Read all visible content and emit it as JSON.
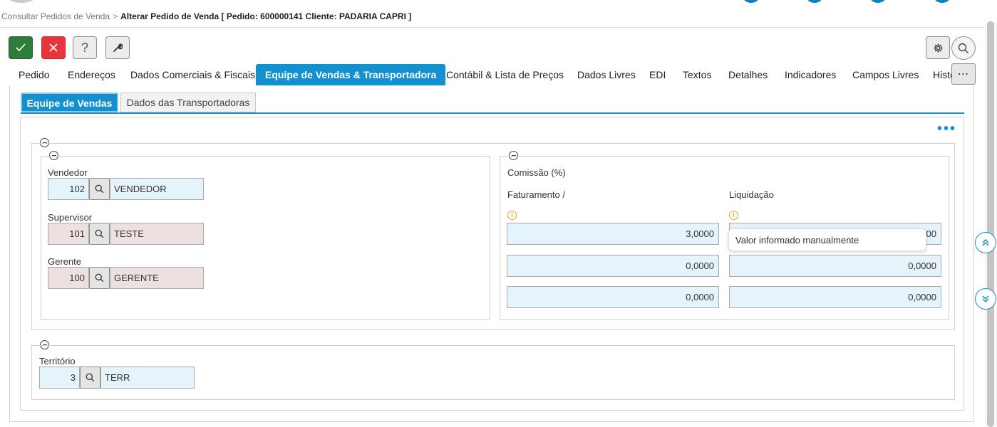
{
  "breadcrumb": {
    "parent": "Consultar Pedidos de Venda",
    "separator": ">",
    "current": "Alterar Pedido de Venda [ Pedido: 600000141 Cliente: PADARIA CAPRI ]"
  },
  "toolbar": {
    "confirm_icon": "check-icon",
    "cancel_icon": "close-icon",
    "help_label": "?",
    "tool_icon": "wrench-icon",
    "settings_icon": "gear-icon",
    "search_icon": "search-icon"
  },
  "tabs": [
    {
      "label": "Pedido"
    },
    {
      "label": "Endereços"
    },
    {
      "label": "Dados Comerciais & Fiscais"
    },
    {
      "label": "Equipe de Vendas & Transportadora",
      "active": true
    },
    {
      "label": "Contábil & Lista de Preços"
    },
    {
      "label": "Dados Livres"
    },
    {
      "label": "EDI"
    },
    {
      "label": "Textos"
    },
    {
      "label": "Detalhes"
    },
    {
      "label": "Indicadores"
    },
    {
      "label": "Campos Livres"
    },
    {
      "label": "Histó"
    }
  ],
  "more_tabs_label": "⋯",
  "subtabs": [
    {
      "label": "Equipe de Vendas",
      "active": true
    },
    {
      "label": "Dados das Transportadoras"
    }
  ],
  "panel_menu_label": "•••",
  "sales_team": {
    "vendedor": {
      "label": "Vendedor",
      "code": "102",
      "name": "VENDEDOR"
    },
    "supervisor": {
      "label": "Supervisor",
      "code": "101",
      "name": "TESTE"
    },
    "gerente": {
      "label": "Gerente",
      "code": "100",
      "name": "GERENTE"
    }
  },
  "commission": {
    "title": "Comissão (%)",
    "col1_label": "Faturamento /",
    "col2_label": "Liquidação",
    "info_glyph": "i",
    "rows": [
      {
        "faturamento": "3,0000",
        "liquidacao": "00"
      },
      {
        "faturamento": "0,0000",
        "liquidacao": "0,0000"
      },
      {
        "faturamento": "0,0000",
        "liquidacao": "0,0000"
      }
    ],
    "tooltip": "Valor informado manualmente"
  },
  "territory": {
    "label": "Território",
    "code": "3",
    "name": "TERR"
  },
  "colors": {
    "accent": "#1390d0",
    "confirm": "#2f7d3a",
    "cancel": "#e9343c",
    "field_blue": "#e5f3fb",
    "field_readonly": "#ede0e0",
    "info": "#f0a020"
  }
}
